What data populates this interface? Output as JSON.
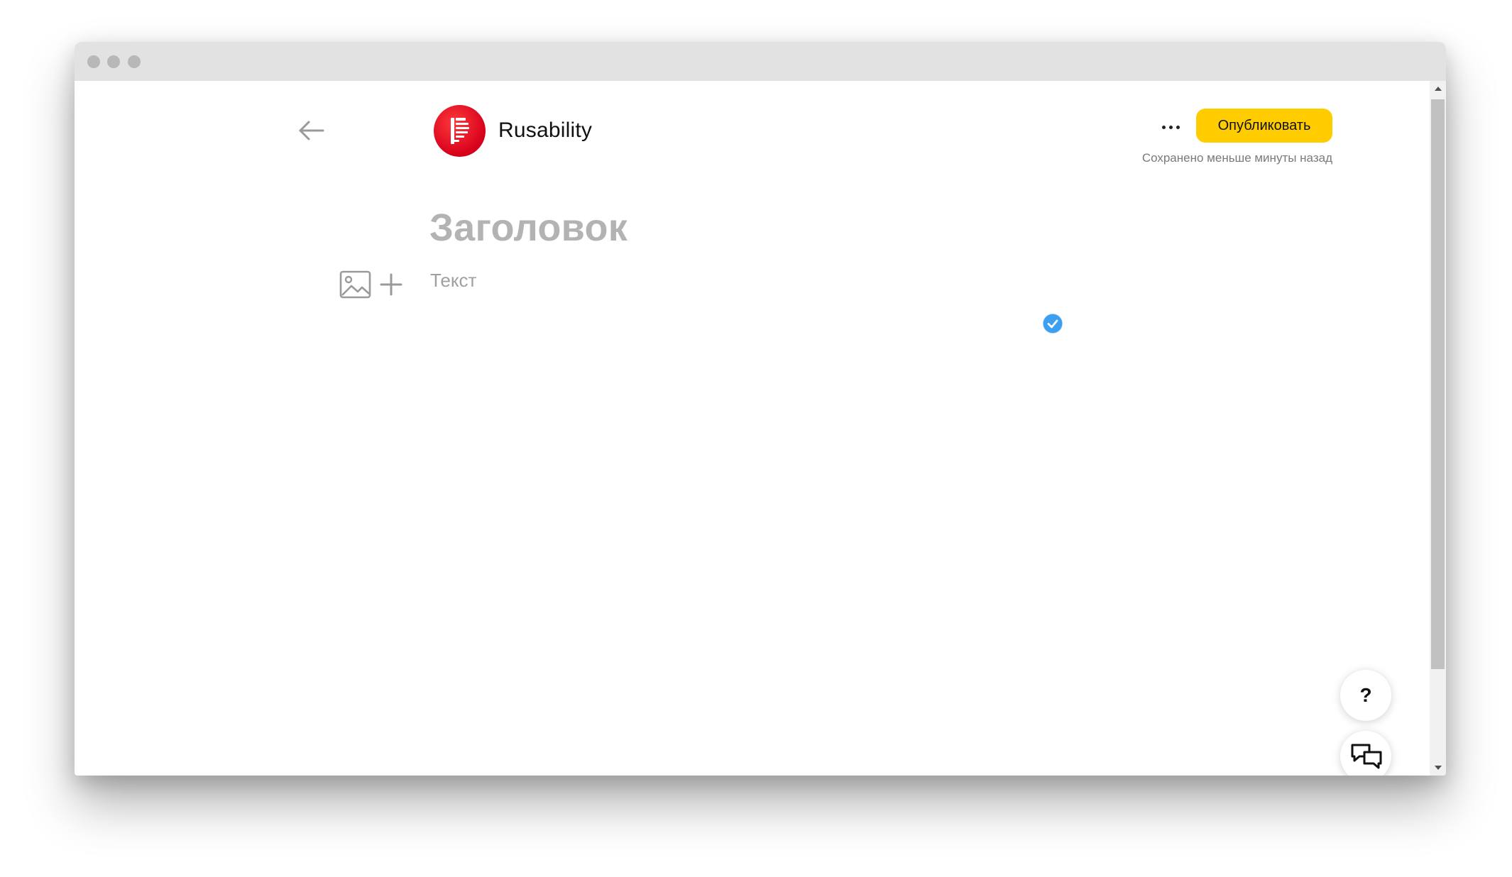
{
  "header": {
    "channel_name": "Rusability",
    "publish_label": "Опубликовать",
    "save_status": "Сохранено меньше минуты назад"
  },
  "editor": {
    "title_placeholder": "Заголовок",
    "text_placeholder": "Текст"
  },
  "floating": {
    "help_label": "?"
  },
  "icons": {
    "back": "arrow-left-icon",
    "more": "more-dots-icon",
    "image": "image-icon",
    "plus": "plus-icon",
    "check": "check-circle-icon",
    "chat": "chat-bubbles-icon"
  },
  "colors": {
    "publish_button": "#ffcc00",
    "avatar": "#e3051b",
    "check_badge": "#3d9ff0",
    "placeholder_title": "#b3b3b3"
  }
}
